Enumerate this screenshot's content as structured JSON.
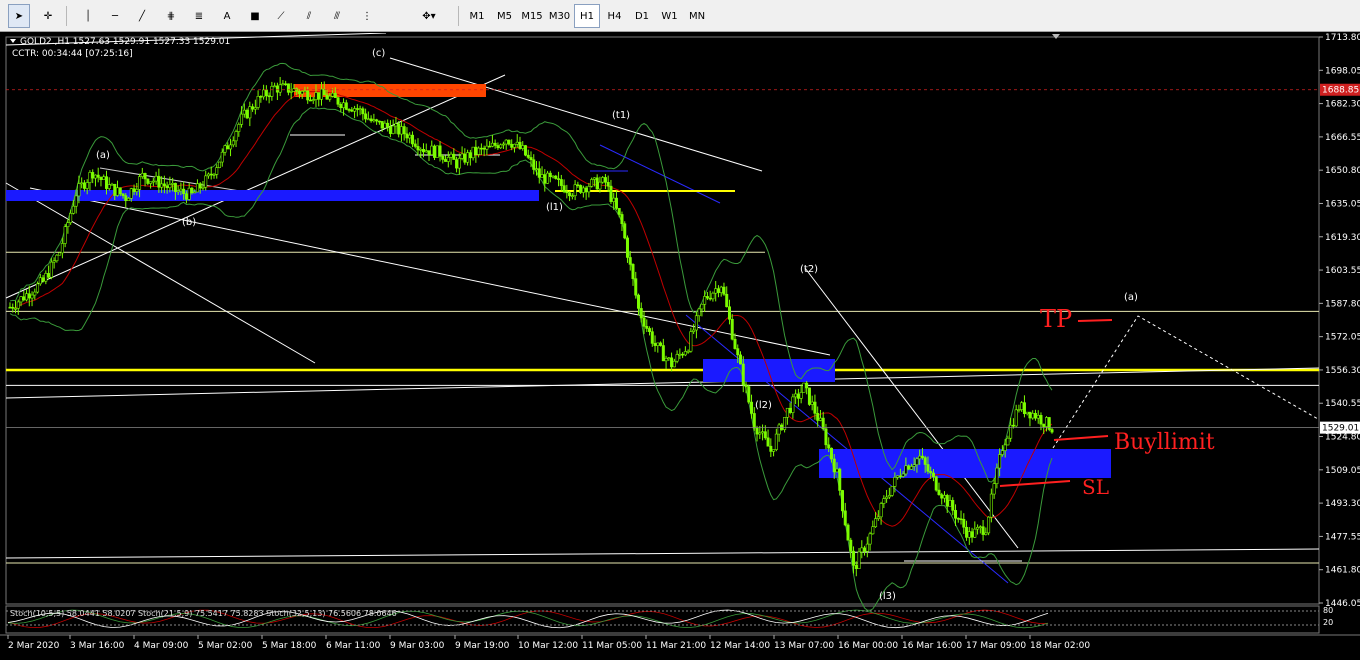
{
  "toolbar": {
    "tools": [
      {
        "name": "cursor-icon",
        "glyph": "➤"
      },
      {
        "name": "crosshair-icon",
        "glyph": "✛"
      },
      {
        "name": "vertical-line-icon",
        "glyph": "│"
      },
      {
        "name": "horizontal-line-icon",
        "glyph": "─"
      },
      {
        "name": "trendline-icon",
        "glyph": "╱"
      },
      {
        "name": "equidistant-channel-icon",
        "glyph": "⋕"
      },
      {
        "name": "fibonacci-retracement-icon",
        "glyph": "≣"
      },
      {
        "name": "text-icon",
        "glyph": "A"
      },
      {
        "name": "text-label-icon",
        "glyph": "■"
      },
      {
        "name": "andrews-pitchfork-icon",
        "glyph": "⟋"
      },
      {
        "name": "fibonacci-fan-icon",
        "glyph": "⫽"
      },
      {
        "name": "fibonacci-arcs-icon",
        "glyph": "⫻"
      },
      {
        "name": "fibonacci-extension-icon",
        "glyph": "⋮"
      },
      {
        "name": "shapes-menu-icon",
        "glyph": "✥▾"
      }
    ],
    "timeframes": [
      "M1",
      "M5",
      "M15",
      "M30",
      "H1",
      "H4",
      "D1",
      "W1",
      "MN"
    ],
    "active_timeframe": "H1"
  },
  "header": {
    "symbol_line": "GOLD2.,H1  1527.63 1529.91 1527.33 1529.01",
    "timer_line": "CCTR: 00:34:44 [07:25:16]"
  },
  "price_axis": {
    "labels": [
      "1713.80",
      "1698.05",
      "1682.30",
      "1666.55",
      "1650.80",
      "1635.05",
      "1619.30",
      "1603.55",
      "1587.80",
      "1572.05",
      "1556.30",
      "1540.55",
      "1524.80",
      "1509.05",
      "1493.30",
      "1477.55",
      "1461.80",
      "1446.05"
    ],
    "current_price": "1529.01",
    "marker_price": "1688.85"
  },
  "time_axis": {
    "labels": [
      "2 Mar 2020",
      "3 Mar 16:00",
      "4 Mar 09:00",
      "5 Mar 02:00",
      "5 Mar 18:00",
      "6 Mar 11:00",
      "9 Mar 03:00",
      "9 Mar 19:00",
      "10 Mar 12:00",
      "11 Mar 05:00",
      "11 Mar 21:00",
      "12 Mar 14:00",
      "13 Mar 07:00",
      "16 Mar 00:00",
      "16 Mar 16:00",
      "17 Mar 09:00",
      "18 Mar 02:00"
    ]
  },
  "wave_labels": [
    "(a)",
    "(b)",
    "(c)",
    "(t1)",
    "(l1)",
    "(t2)",
    "(l2)",
    "(l3)",
    "(a)"
  ],
  "annotations": {
    "tp": "TP",
    "buy_limit": "Buyllimit",
    "sl": "SL"
  },
  "oscillator": {
    "label": "Stoch(10,5,5) 58.0441 58.0207  Stoch(21,5,9) 75.5417 75.8283  Stoch(32,5,13) 76.5606 78.0646",
    "levels": [
      "80",
      "20"
    ]
  },
  "colors": {
    "candle": "#7cfc00",
    "support_zone": "#1a1aff",
    "supply_zone": "#ff4500",
    "key_level": "#ffff00",
    "moving_average": "#c00000",
    "handwriting": "#ff2020"
  },
  "chart_data": {
    "type": "candlestick",
    "instrument": "GOLD2.",
    "timeframe": "H1",
    "ylim": [
      1446.05,
      1713.8
    ],
    "ohlc_last": {
      "open": 1527.63,
      "high": 1529.91,
      "low": 1527.33,
      "close": 1529.01
    },
    "key_levels": [
      1688.85,
      1556.3
    ],
    "price_path": [
      1586,
      1592,
      1598,
      1612,
      1640,
      1650,
      1643,
      1638,
      1648,
      1645,
      1641,
      1639,
      1647,
      1660,
      1675,
      1684,
      1690,
      1689,
      1687,
      1686,
      1683,
      1680,
      1673,
      1671,
      1668,
      1661,
      1659,
      1654,
      1659,
      1661,
      1666,
      1660,
      1648,
      1645,
      1641,
      1644,
      1645,
      1625,
      1585,
      1568,
      1559,
      1568,
      1590,
      1597,
      1562,
      1531,
      1518,
      1537,
      1548,
      1531,
      1507,
      1462,
      1478,
      1497,
      1510,
      1515,
      1502,
      1490,
      1478,
      1482,
      1520,
      1539,
      1535,
      1529
    ]
  }
}
